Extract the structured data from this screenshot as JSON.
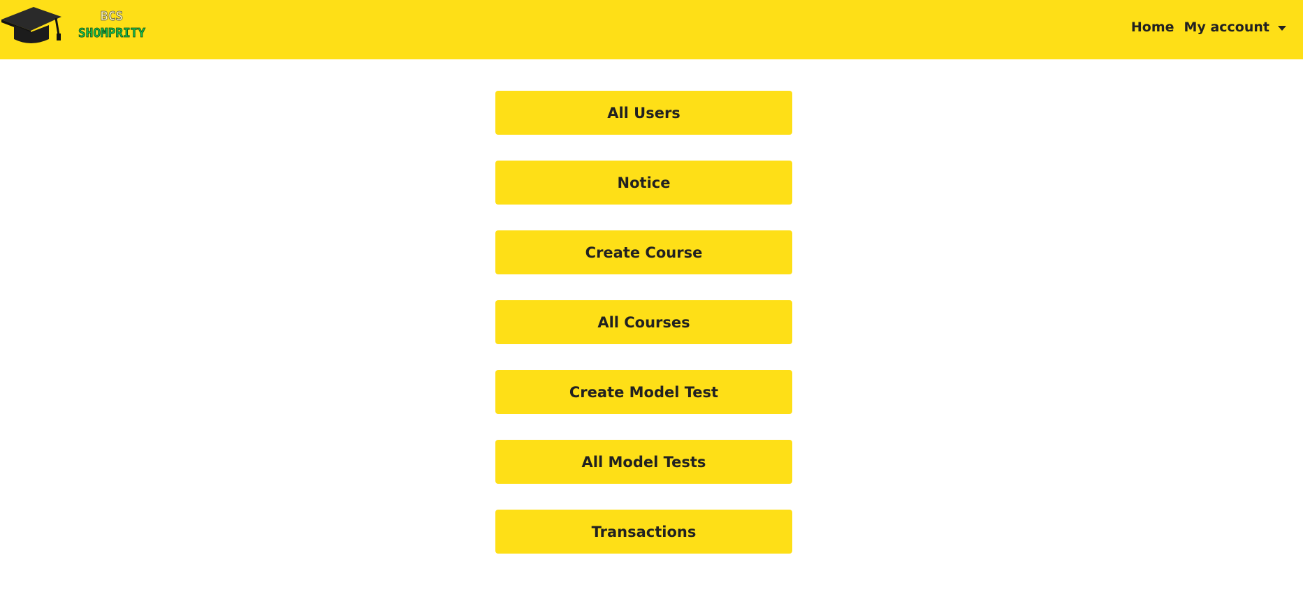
{
  "brand": {
    "line1": "BCS",
    "line2": "SHOMPRITY",
    "icon": "graduation-cap-icon"
  },
  "nav": {
    "home": "Home",
    "account": "My account",
    "account_icon": "caret-down-icon"
  },
  "menu": [
    "All Users",
    "Notice",
    "Create Course",
    "All Courses",
    "Create Model Test",
    "All Model Tests",
    "Transactions"
  ],
  "colors": {
    "navbar": "#fedf17",
    "button": "#fedf17",
    "text": "#212121",
    "brand_green": "#19c24a"
  }
}
